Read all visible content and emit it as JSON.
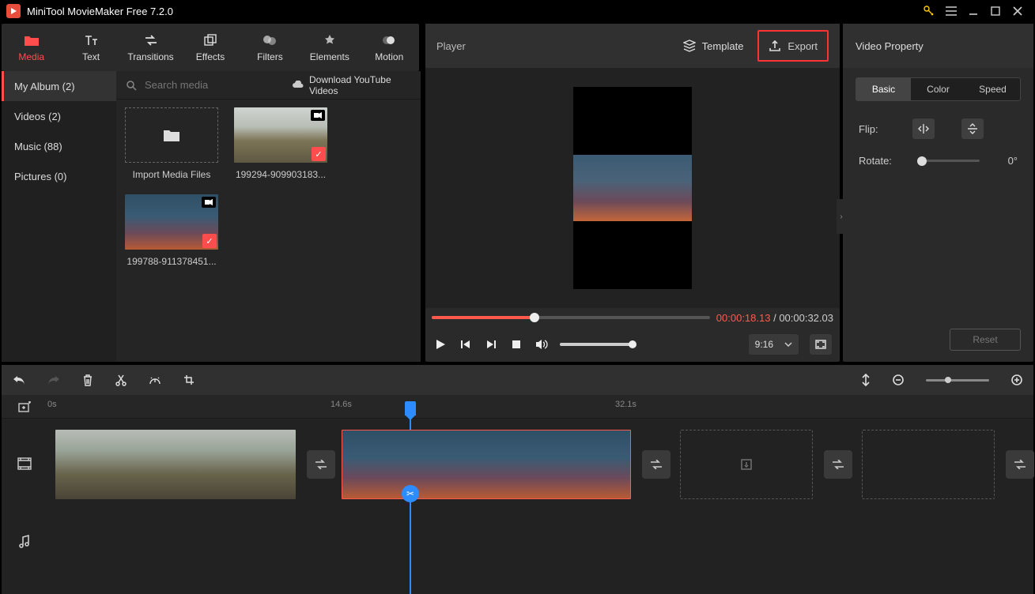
{
  "app": {
    "title": "MiniTool MovieMaker Free 7.2.0"
  },
  "toolbar": {
    "items": [
      {
        "label": "Media"
      },
      {
        "label": "Text"
      },
      {
        "label": "Transitions"
      },
      {
        "label": "Effects"
      },
      {
        "label": "Filters"
      },
      {
        "label": "Elements"
      },
      {
        "label": "Motion"
      }
    ]
  },
  "sidebar": {
    "items": [
      {
        "label": "My Album (2)"
      },
      {
        "label": "Videos (2)"
      },
      {
        "label": "Music (88)"
      },
      {
        "label": "Pictures (0)"
      }
    ]
  },
  "media": {
    "search_placeholder": "Search media",
    "ytlink": "Download YouTube Videos",
    "items": [
      {
        "label": "Import Media Files",
        "kind": "import"
      },
      {
        "label": "199294-909903183...",
        "kind": "video"
      },
      {
        "label": "199788-911378451...",
        "kind": "video"
      }
    ]
  },
  "player": {
    "title": "Player",
    "template": "Template",
    "export": "Export",
    "current": "00:00:18.13",
    "total": "00:00:32.03",
    "aspect": "9:16"
  },
  "props": {
    "title": "Video Property",
    "tabs": [
      "Basic",
      "Color",
      "Speed"
    ],
    "flip": "Flip:",
    "rotate": "Rotate:",
    "rotate_val": "0°",
    "reset": "Reset"
  },
  "timeline": {
    "marks": [
      {
        "label": "0s",
        "pos": 0
      },
      {
        "label": "14.6s",
        "pos": 358
      },
      {
        "label": "32.1s",
        "pos": 718
      }
    ]
  }
}
